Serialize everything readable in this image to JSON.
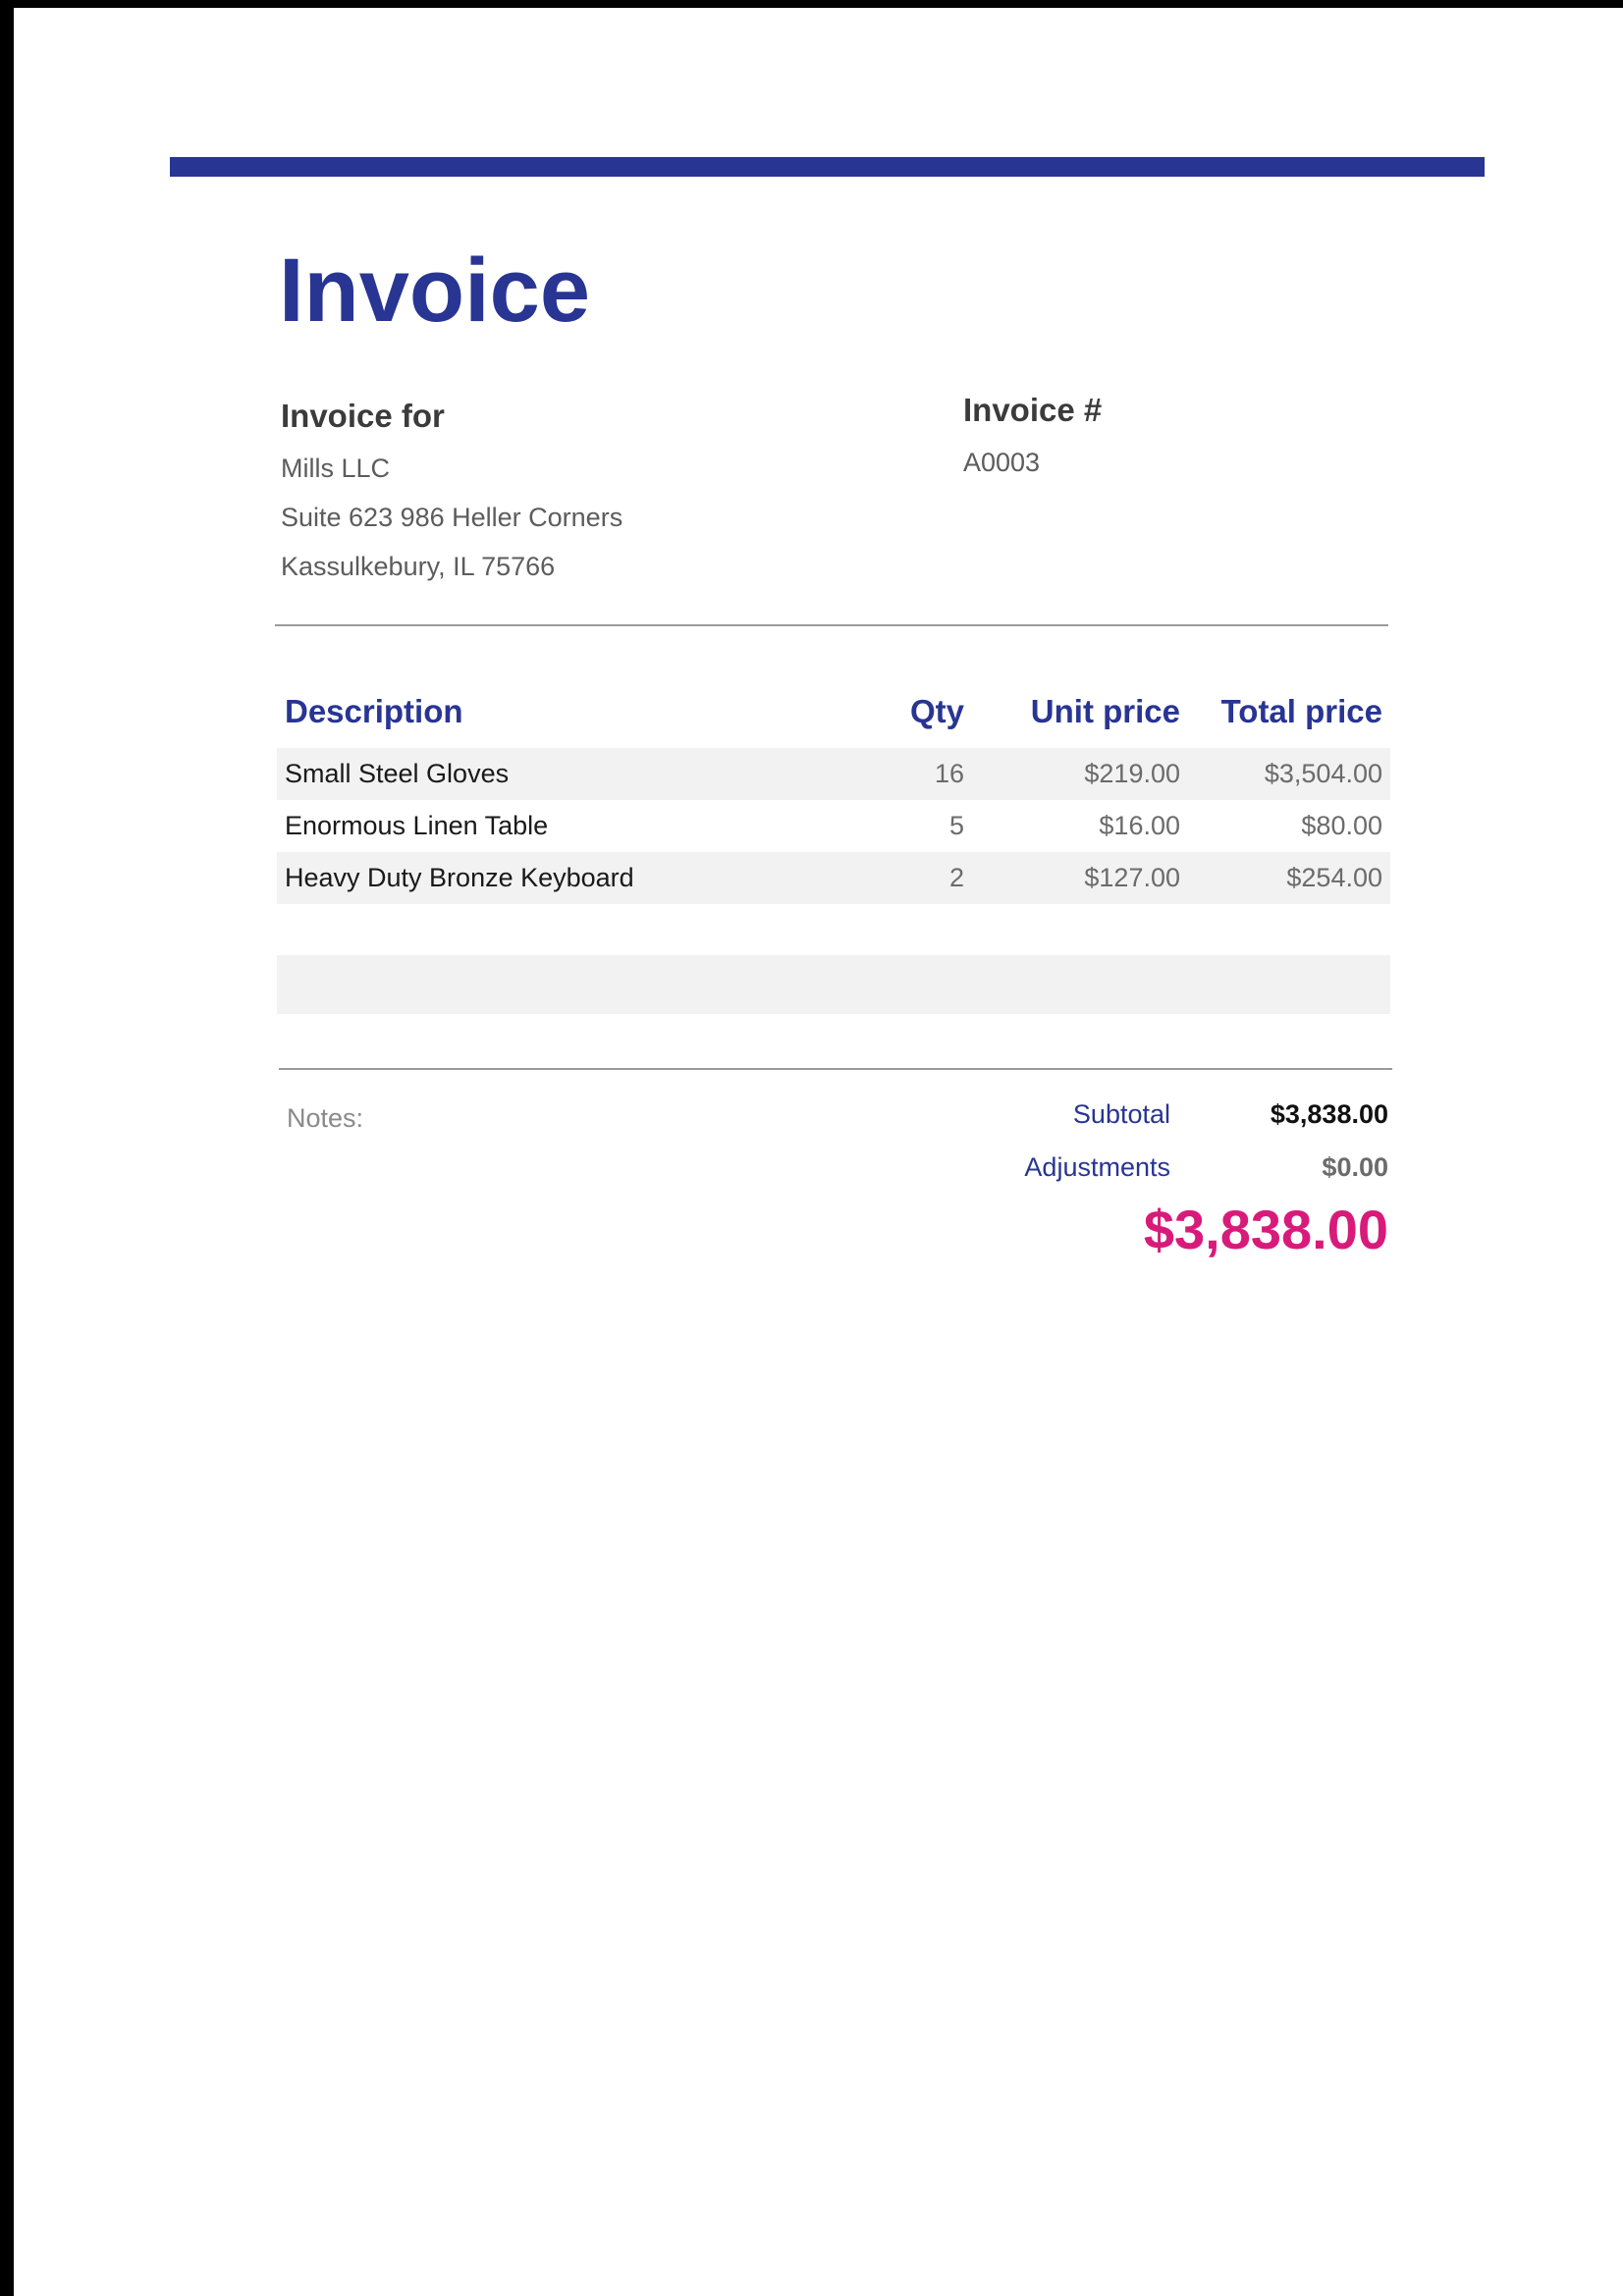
{
  "document": {
    "title": "Invoice"
  },
  "bill_to": {
    "label": "Invoice for",
    "company": "Mills LLC",
    "address_line1": "Suite 623 986 Heller Corners",
    "address_line2": "Kassulkebury, IL 75766"
  },
  "invoice_number": {
    "label": "Invoice #",
    "value": "A0003"
  },
  "table": {
    "headers": {
      "description": "Description",
      "qty": "Qty",
      "unit_price": "Unit price",
      "total_price": "Total price"
    },
    "rows": [
      {
        "description": "Small Steel Gloves",
        "qty": "16",
        "unit_price": "$219.00",
        "total_price": "$3,504.00"
      },
      {
        "description": "Enormous Linen Table",
        "qty": "5",
        "unit_price": "$16.00",
        "total_price": "$80.00"
      },
      {
        "description": "Heavy Duty Bronze Keyboard",
        "qty": "2",
        "unit_price": "$127.00",
        "total_price": "$254.00"
      }
    ]
  },
  "notes": {
    "label": "Notes:"
  },
  "totals": {
    "subtotal_label": "Subtotal",
    "subtotal_value": "$3,838.00",
    "adjustments_label": "Adjustments",
    "adjustments_value": "$0.00",
    "grand_total": "$3,838.00"
  },
  "colors": {
    "accent": "#283593",
    "total": "#d81b7a",
    "row_shade": "#f2f2f2"
  }
}
